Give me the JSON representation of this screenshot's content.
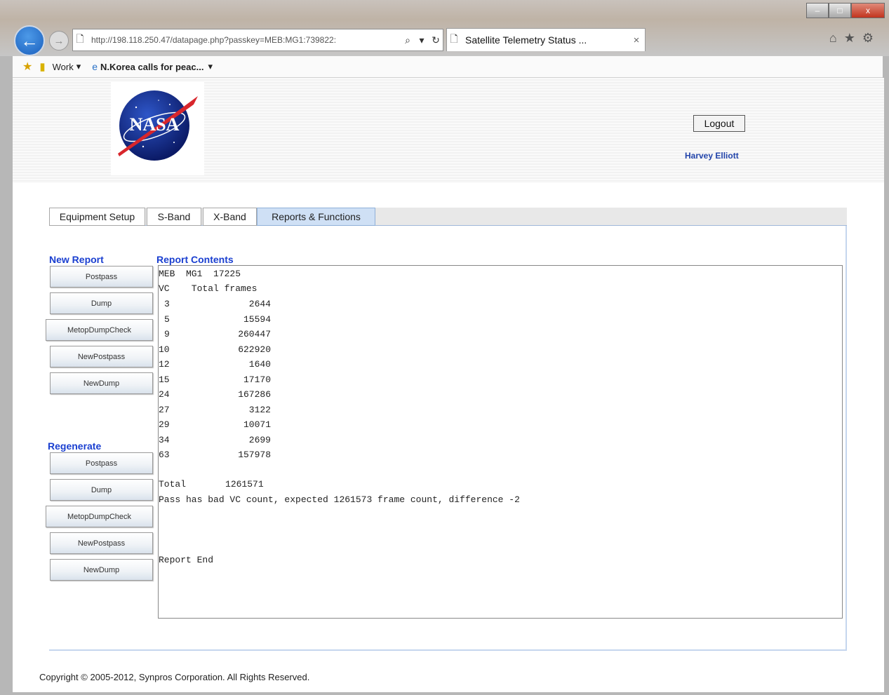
{
  "browser": {
    "url": "http://198.118.250.47/datapage.php?passkey=MEB:MG1:739822:",
    "tab_title": "Satellite Telemetry Status ...",
    "tab_close": "×",
    "fav_work": "Work",
    "fav_news": "N.Korea calls for peac...",
    "window_minimize": "–",
    "window_maximize": "□",
    "window_close": "x"
  },
  "header": {
    "logo_text": "NASA",
    "logout_label": "Logout",
    "user_name": "Harvey Elliott"
  },
  "tabs": [
    {
      "label": "Equipment Setup"
    },
    {
      "label": "S-Band"
    },
    {
      "label": "X-Band"
    },
    {
      "label": "Reports & Functions"
    }
  ],
  "new_report": {
    "title": "New Report",
    "buttons": [
      "Postpass",
      "Dump",
      "MetopDumpCheck",
      "NewPostpass",
      "NewDump"
    ]
  },
  "regenerate": {
    "title": "Regenerate",
    "buttons": [
      "Postpass",
      "Dump",
      "MetopDumpCheck",
      "NewPostpass",
      "NewDump"
    ]
  },
  "report": {
    "title": "Report Contents",
    "header_line": "MEB  MG1  17225",
    "column_header": "VC    Total frames",
    "rows": [
      {
        "vc": "3",
        "frames": "2644"
      },
      {
        "vc": "5",
        "frames": "15594"
      },
      {
        "vc": "9",
        "frames": "260447"
      },
      {
        "vc": "10",
        "frames": "622920"
      },
      {
        "vc": "12",
        "frames": "1640"
      },
      {
        "vc": "15",
        "frames": "17170"
      },
      {
        "vc": "24",
        "frames": "167286"
      },
      {
        "vc": "27",
        "frames": "3122"
      },
      {
        "vc": "29",
        "frames": "10071"
      },
      {
        "vc": "34",
        "frames": "2699"
      },
      {
        "vc": "63",
        "frames": "157978"
      }
    ],
    "total_label": "Total",
    "total_value": "1261571",
    "message": "Pass has bad VC count, expected 1261573 frame count, difference -2",
    "end_text": "Report End"
  },
  "footer": {
    "copyright": "Copyright © 2005-2012, Synpros Corporation. All Rights Reserved."
  }
}
